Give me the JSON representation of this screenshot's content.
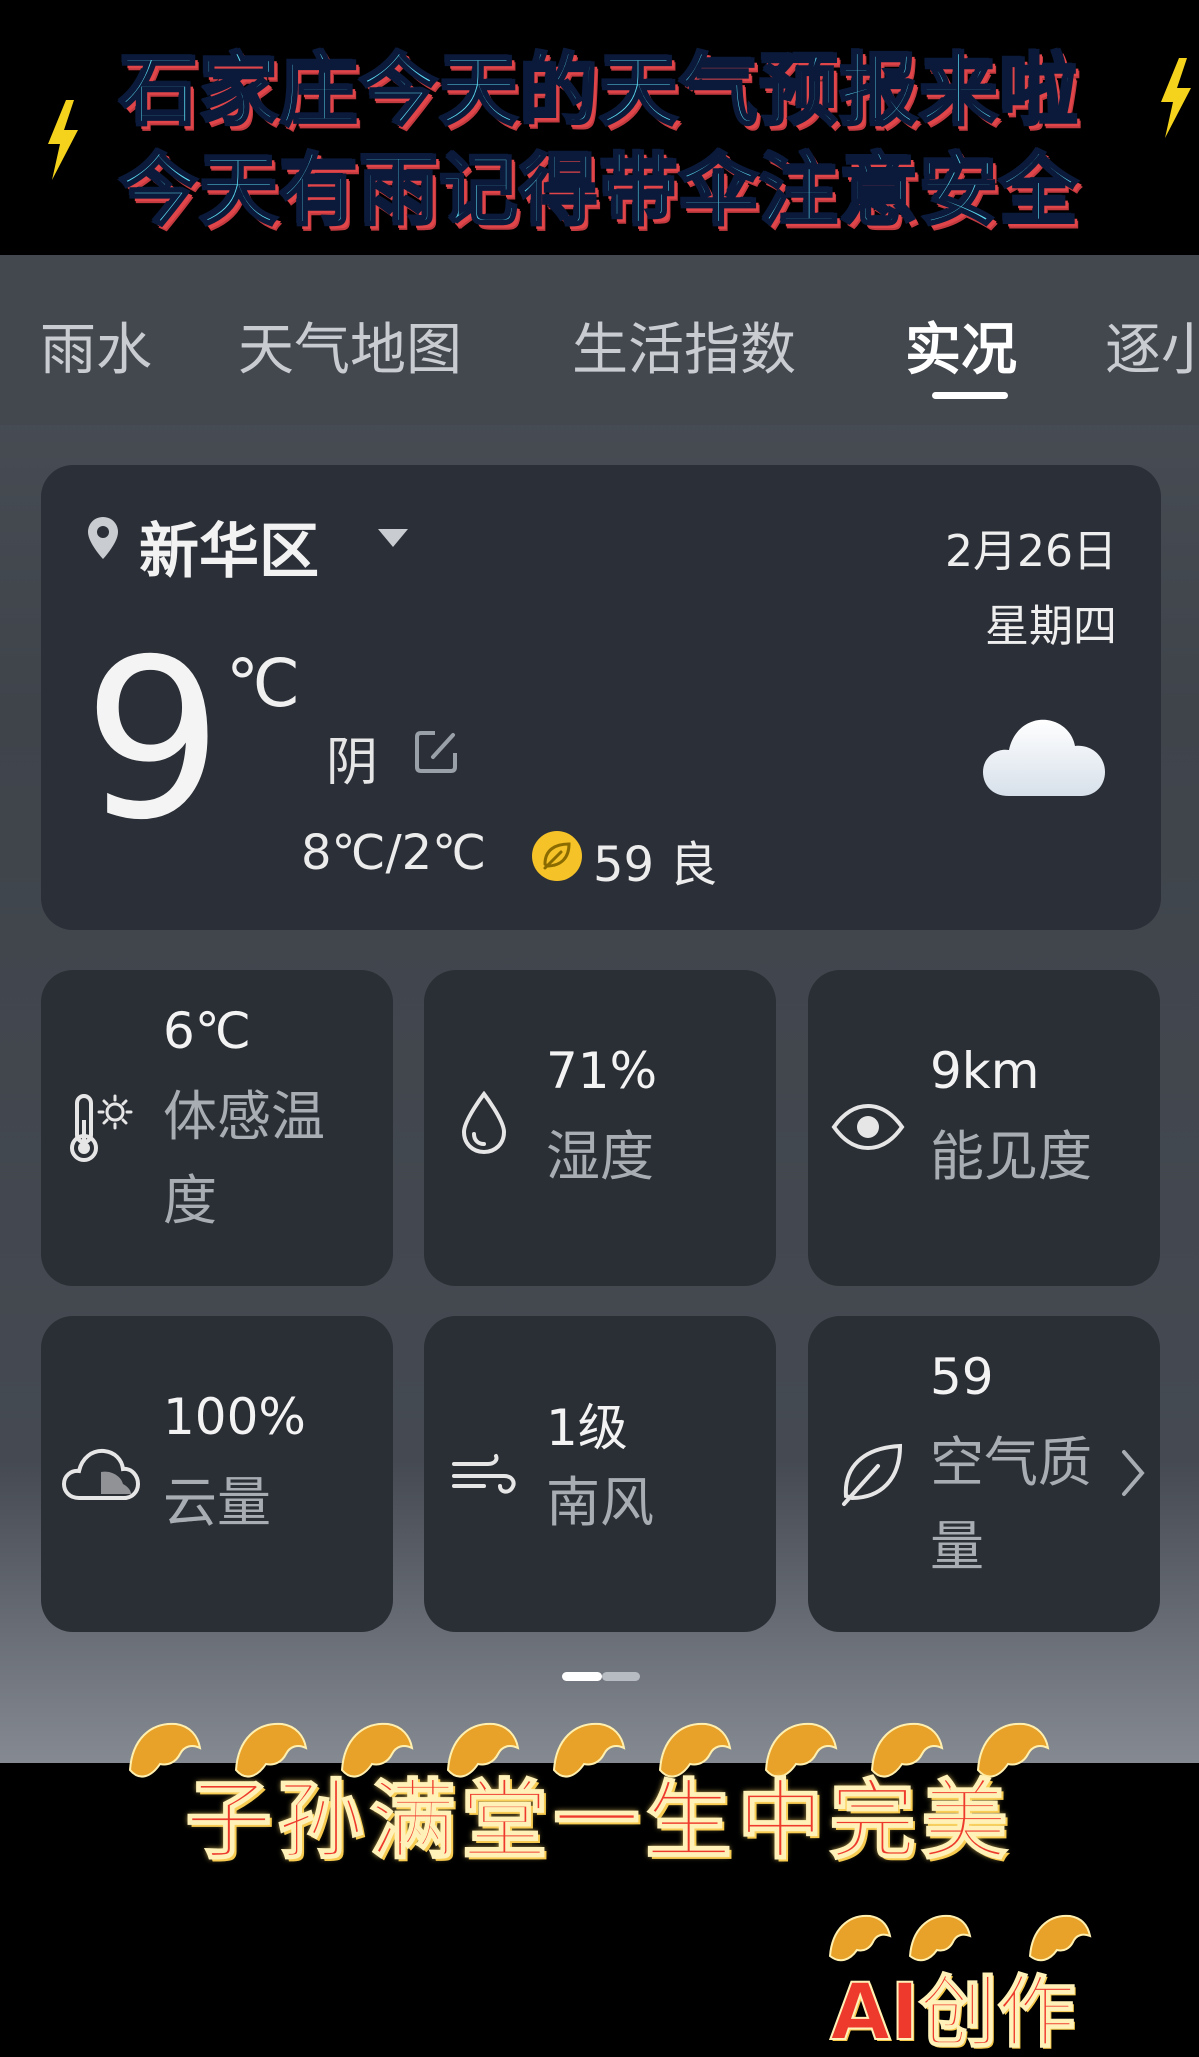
{
  "banner": {
    "line1": "石家庄今天的天气预报来啦",
    "line2": "今天有雨记得带伞注意安全"
  },
  "tabs": [
    {
      "label": "雨水"
    },
    {
      "label": "天气地图"
    },
    {
      "label": "生活指数"
    },
    {
      "label": "实况",
      "active": true
    },
    {
      "label": "逐小"
    }
  ],
  "current": {
    "location": "新华区",
    "date": "2月26日",
    "weekday": "星期四",
    "temperature": "9",
    "unit": "℃",
    "condition": "阴",
    "range": "8℃/2℃",
    "aqi": "59 良",
    "weather_icon": "cloud-icon"
  },
  "stats": [
    {
      "value": "6℃",
      "label": "体感温度",
      "icon": "thermometer-sun-icon"
    },
    {
      "value": "71%",
      "label": "湿度",
      "icon": "droplet-icon"
    },
    {
      "value": "9km",
      "label": "能见度",
      "icon": "eye-icon"
    },
    {
      "value": "100%",
      "label": "云量",
      "icon": "cloud-icon"
    },
    {
      "value": "1级",
      "label": "南风",
      "icon": "wind-icon"
    },
    {
      "value": "59",
      "label": "空气质量",
      "icon": "leaf-icon"
    }
  ],
  "footer": {
    "blessing": "子孙满堂一生中完美",
    "ai_tag": "AI创作"
  },
  "colors": {
    "app_bg": "#43474e",
    "card_bg": "#2a2e35",
    "banner_text": "#5ad8ef",
    "aqi_badge": "#f5c228",
    "blessing_text": "#ee3a2c"
  }
}
